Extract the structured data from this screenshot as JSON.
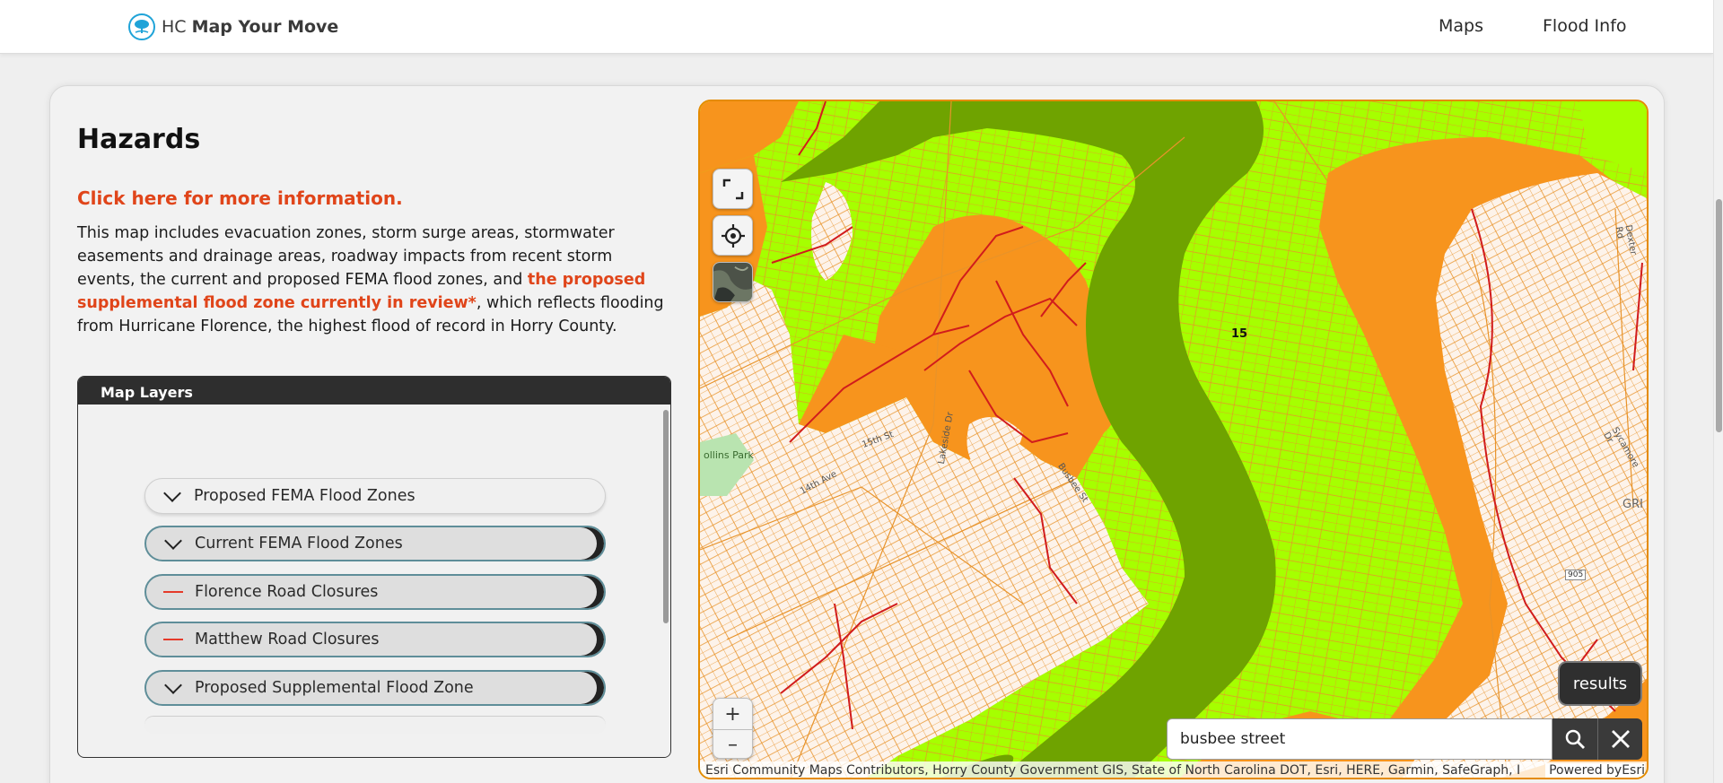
{
  "header": {
    "brand_prefix": "HC",
    "brand_name": "Map Your Move",
    "nav": [
      "Maps",
      "Flood Info"
    ]
  },
  "content": {
    "title": "Hazards",
    "more_info_link": "Click here for more information.",
    "description_1": "This map includes evacuation zones, storm surge areas, stormwater easements and drainage areas, roadway impacts from recent storm events, the current and proposed FEMA flood zones, and ",
    "description_link": "the proposed supplemental flood zone currently in review*",
    "description_2": ", which reflects flooding from Hurricane Florence, the highest flood of record in Horry County."
  },
  "layers_panel": {
    "title": "Map Layers",
    "items": [
      {
        "label": "Proposed FEMA Flood Zones",
        "icon": "chevron-down-icon"
      },
      {
        "label": "Current FEMA Flood Zones",
        "icon": "chevron-down-icon"
      },
      {
        "label": "Florence Road Closures",
        "icon": "red-line-icon"
      },
      {
        "label": "Matthew Road Closures",
        "icon": "red-line-icon"
      },
      {
        "label": "Proposed Supplemental Flood Zone",
        "icon": "chevron-down-icon"
      }
    ]
  },
  "map": {
    "zone_label": "15",
    "place_labels": {
      "park": "ollins Park",
      "road_1": "Lakeside Dr",
      "road_2": "15th St",
      "road_3": "14th Ave",
      "road_4": "Busbee St",
      "road_5": "Dexter Rd",
      "road_6": "Sycamore Dr",
      "edge_text": "GRI",
      "route": "905"
    },
    "results_label": "results",
    "search": {
      "value": "busbee street"
    },
    "zoom_in": "+",
    "zoom_out": "–",
    "attribution": "Esri Community Maps Contributors, Horry County Government GIS, State of North Carolina DOT, Esri, HERE, Garmin, SafeGraph, I",
    "powered_by": "Powered byEsri",
    "colors": {
      "high_risk": "#f7941d",
      "moderate": "#a6ff00",
      "floodway": "#6fa300",
      "land": "#fdf3ea",
      "parcel_line": "#e8932a",
      "road_closure": "#d11c1c",
      "park": "#b9e4b0"
    }
  },
  "colors": {
    "accent": "#e0451a",
    "panel_header": "#2e2e2e",
    "layer_border": "#5f8e99"
  }
}
